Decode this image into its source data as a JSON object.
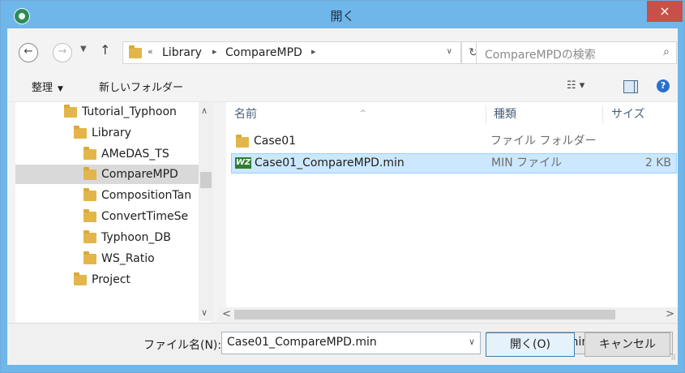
{
  "window": {
    "title": "開く",
    "close_symbol": "×",
    "app_icon": "app-icon"
  },
  "address": {
    "back_symbol": "←",
    "forward_symbol": "→",
    "recent_symbol": "▼",
    "up_symbol": "↑",
    "overflow": "«",
    "segments": [
      "Library",
      "CompareMPD"
    ],
    "separator": "▸",
    "dropdown_symbol": "∨",
    "refresh_symbol": "↻",
    "search_placeholder": "CompareMPDの検索",
    "search_icon": "⌕"
  },
  "toolbar": {
    "organize": "整理",
    "organize_caret": "▼",
    "new_folder": "新しいフォルダー",
    "view_symbol": "☷ ▾",
    "help_symbol": "?"
  },
  "tree": {
    "items": [
      {
        "label": "Tutorial_Typhoon",
        "selected": false
      },
      {
        "label": "Library",
        "selected": false
      },
      {
        "label": "AMeDAS_TS",
        "selected": false
      },
      {
        "label": "CompareMPD",
        "selected": true
      },
      {
        "label": "CompositionTan",
        "selected": false
      },
      {
        "label": "ConvertTimeSe",
        "selected": false
      },
      {
        "label": "Typhoon_DB",
        "selected": false
      },
      {
        "label": "WS_Ratio",
        "selected": false
      },
      {
        "label": "Project",
        "selected": false
      }
    ],
    "scroll_up": "∧",
    "scroll_down": "∨"
  },
  "files": {
    "columns": {
      "name": "名前",
      "type": "種類",
      "size": "サイズ"
    },
    "sort_caret": "^",
    "rows": [
      {
        "name": "Case01",
        "type": "ファイル フォルダー",
        "size": "",
        "icon": "folder-icon",
        "selected": false
      },
      {
        "name": "Case01_CompareMPD.min",
        "type": "MIN ファイル",
        "size": "2 KB",
        "icon": "min-file-icon",
        "icon_text": "WZ",
        "selected": true
      }
    ],
    "scroll_left": "<",
    "scroll_right": ">"
  },
  "bottom": {
    "filename_label": "ファイル名(N):",
    "filename_value": "Case01_CompareMPD.min",
    "filter_value": "Setting file(*.min)",
    "open_label": "開く(O)",
    "cancel_label": "キャンセル",
    "caret": "∨",
    "grip": "⠿"
  },
  "colors": {
    "titlebar": "#6fb6ea",
    "close": "#c7504a",
    "selection": "#cce8ff",
    "folder": "#e3b64b"
  }
}
